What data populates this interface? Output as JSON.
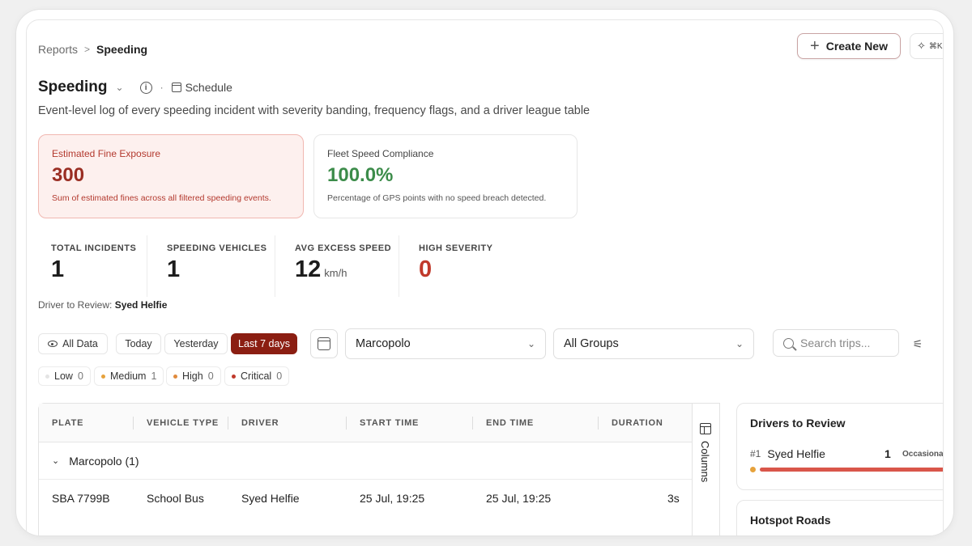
{
  "breadcrumb": {
    "parent": "Reports",
    "separator": ">",
    "current": "Speeding"
  },
  "header": {
    "create_label": "Create New",
    "shortcut": "⌘K"
  },
  "page": {
    "title": "Speeding",
    "schedule_label": "Schedule",
    "subtitle": "Event-level log of every speeding incident with severity banding, frequency flags, and a driver league table"
  },
  "cards": {
    "fine": {
      "label": "Estimated Fine Exposure",
      "value": "300",
      "description": "Sum of estimated fines across all filtered speeding events."
    },
    "compliance": {
      "label": "Fleet Speed Compliance",
      "value": "100.0%",
      "description": "Percentage of GPS points with no speed breach detected."
    }
  },
  "stats": {
    "total_incidents": {
      "label": "TOTAL INCIDENTS",
      "value": "1"
    },
    "speeding_vehicles": {
      "label": "SPEEDING VEHICLES",
      "value": "1"
    },
    "avg_excess": {
      "label": "AVG EXCESS SPEED",
      "value": "12",
      "unit": "km/h"
    },
    "high_severity": {
      "label": "HIGH SEVERITY",
      "value": "0"
    }
  },
  "review": {
    "label": "Driver to Review:",
    "driver": "Syed Helfie"
  },
  "filters": {
    "all_data": "All Data",
    "today": "Today",
    "yesterday": "Yesterday",
    "last7": "Last 7 days",
    "company": "Marcopolo",
    "groups": "All Groups",
    "search_placeholder": "Search trips..."
  },
  "severity": {
    "low": {
      "label": "Low",
      "count": "0",
      "color": "#e4e4e4"
    },
    "medium": {
      "label": "Medium",
      "count": "1",
      "color": "#e6a23c"
    },
    "high": {
      "label": "High",
      "count": "0",
      "color": "#e08a3c"
    },
    "critical": {
      "label": "Critical",
      "count": "0",
      "color": "#c0392b"
    }
  },
  "table": {
    "columns": [
      "PLATE",
      "VEHICLE TYPE",
      "DRIVER",
      "START TIME",
      "END TIME",
      "DURATION"
    ],
    "group_label": "Marcopolo (1)",
    "rows": [
      {
        "plate": "SBA 7799B",
        "vehicle_type": "School Bus",
        "driver": "Syed Helfie",
        "start": "25 Jul, 19:25",
        "end": "25 Jul, 19:25",
        "duration": "3s"
      }
    ],
    "columns_button": "Columns"
  },
  "drivers_to_review": {
    "title": "Drivers to Review",
    "items": [
      {
        "rank": "#1",
        "name": "Syed Helfie",
        "count": "1",
        "flag": "Occasional"
      }
    ]
  },
  "hotspot": {
    "title": "Hotspot Roads"
  },
  "colors": {
    "accent": "#8b1e12",
    "fine_bg": "#fdf0ee",
    "success": "#3c8c4a",
    "danger": "#c0392b"
  }
}
